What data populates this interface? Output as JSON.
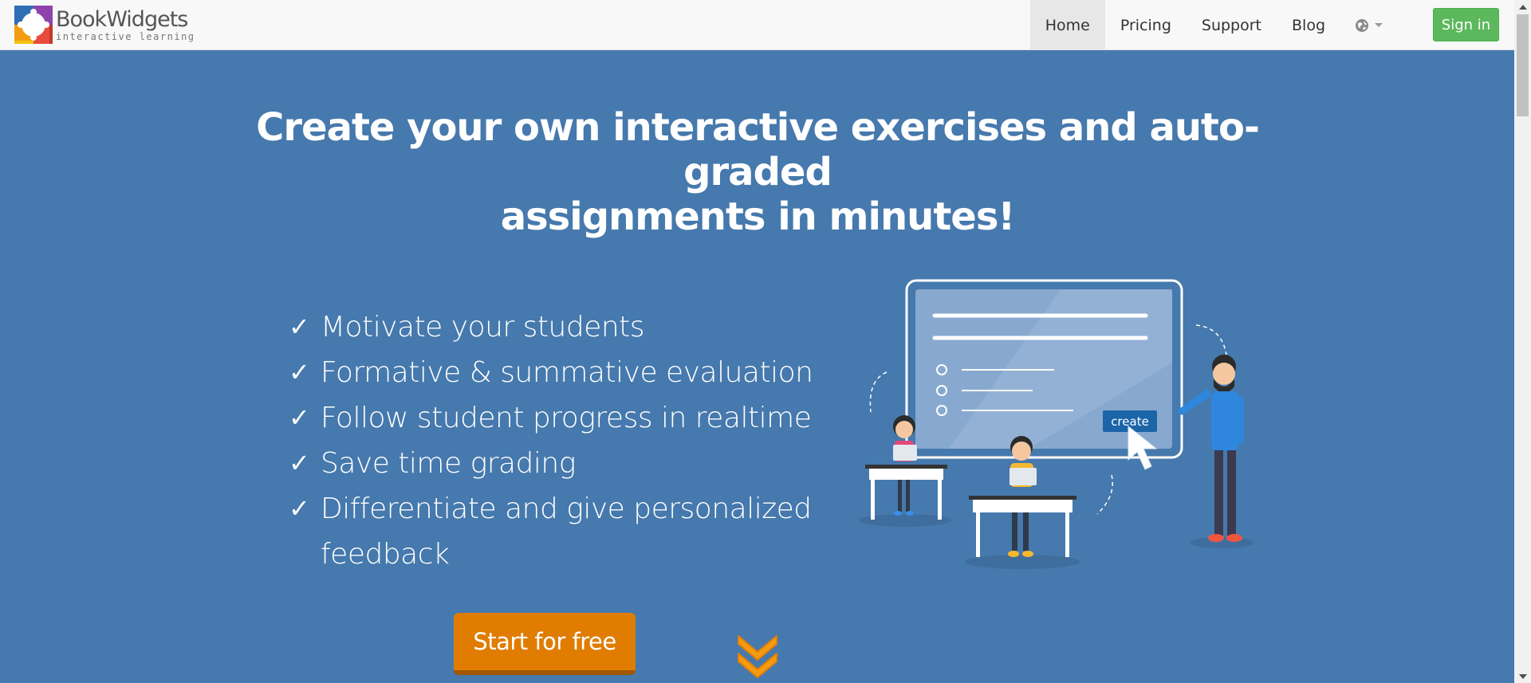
{
  "brand": {
    "name": "BookWidgets",
    "tagline": "interactive learning"
  },
  "nav": {
    "items": [
      {
        "label": "Home",
        "active": true
      },
      {
        "label": "Pricing",
        "active": false
      },
      {
        "label": "Support",
        "active": false
      },
      {
        "label": "Blog",
        "active": false
      }
    ],
    "language_icon": "globe-icon",
    "signin_label": "Sign in"
  },
  "hero": {
    "headline_line1": "Create your own interactive exercises and auto-graded",
    "headline_line2": "assignments in minutes!",
    "features": [
      "Motivate your students",
      "Formative & summative evaluation",
      "Follow student progress in realtime",
      "Save time grading",
      "Differentiate and give personalized feedback"
    ],
    "check_glyph": "✓",
    "cta_label": "Start for free",
    "illustration_button_label": "create"
  },
  "colors": {
    "hero_bg": "#4679ad",
    "cta": "#e07c00",
    "signin": "#5cb85c",
    "scroll_arrow": "#f39c12"
  }
}
